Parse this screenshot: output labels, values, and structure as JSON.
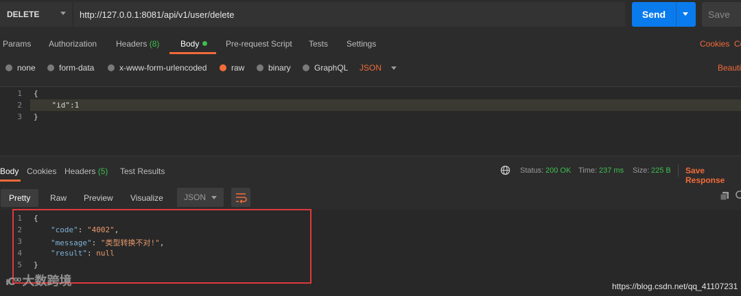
{
  "request": {
    "method": "DELETE",
    "url": "http://127.0.0.1:8081/api/v1/user/delete",
    "send_label": "Send",
    "save_label": "Save"
  },
  "request_tabs": {
    "params": "Params",
    "authorization": "Authorization",
    "headers": "Headers",
    "headers_count": "(8)",
    "body": "Body",
    "prerequest": "Pre-request Script",
    "tests": "Tests",
    "settings": "Settings",
    "cookies": "Cookies",
    "code_partial": "Co"
  },
  "body_types": {
    "none": "none",
    "form_data": "form-data",
    "urlencoded": "x-www-form-urlencoded",
    "raw": "raw",
    "binary": "binary",
    "graphql": "GraphQL",
    "format": "JSON",
    "beautify": "Beauti",
    "selected": "raw"
  },
  "request_body": {
    "line_numbers": [
      "1",
      "2",
      "3"
    ],
    "lines": [
      "{",
      "    \"id\":1",
      "}"
    ]
  },
  "response_tabs": {
    "body": "Body",
    "cookies": "Cookies",
    "headers": "Headers",
    "headers_count": "(5)",
    "test_results": "Test Results"
  },
  "response_status": {
    "status_label": "Status:",
    "status_value": "200 OK",
    "time_label": "Time:",
    "time_value": "237 ms",
    "size_label": "Size:",
    "size_value": "225 B",
    "save_response": "Save Response"
  },
  "response_views": {
    "pretty": "Pretty",
    "raw": "Raw",
    "preview": "Preview",
    "visualize": "Visualize",
    "format": "JSON"
  },
  "response_body": {
    "line_numbers": [
      "1",
      "2",
      "3",
      "4",
      "5"
    ],
    "open": "{",
    "code_key": "\"code\"",
    "code_val": "\"4002\"",
    "message_key": "\"message\"",
    "message_val": "\"类型转换不对!\"",
    "result_key": "\"result\"",
    "result_val": "null",
    "close": "}"
  },
  "watermark": "大数跨境",
  "footer_url": "https://blog.csdn.net/qq_41107231",
  "colors": {
    "accent": "#f26b3a",
    "send_blue": "#097bed",
    "success_green": "#3ebf4f",
    "highlight_red": "#e0393e"
  }
}
